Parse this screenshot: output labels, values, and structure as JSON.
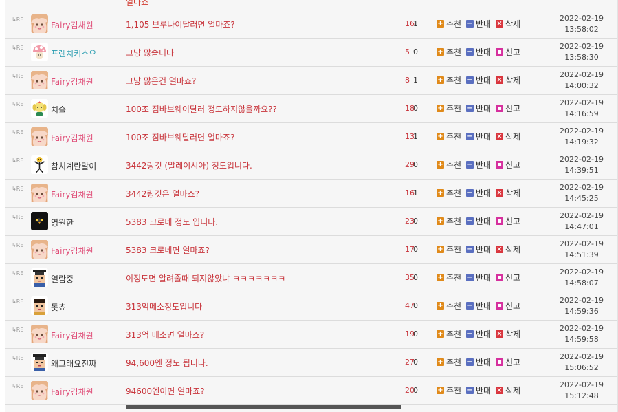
{
  "top": {
    "cut_text": "얼마죠"
  },
  "labels": {
    "re": "↳RE",
    "recommend": "추천",
    "oppose": "반대",
    "delete": "삭제",
    "report": "신고"
  },
  "rows": [
    {
      "nick": "Fairy김채원",
      "nick_color": "pink",
      "avatar": "fairy",
      "content": "1,105 브루나이달러면 얼마죠?",
      "up": "16",
      "down": "1",
      "action": "delete",
      "date": "2022-02-19",
      "time": "13:58:02"
    },
    {
      "nick": "프렌치키스으",
      "nick_color": "teal",
      "avatar": "mushroom",
      "content": "그냥 많습니다",
      "up": "5",
      "down": "0",
      "action": "report",
      "date": "2022-02-19",
      "time": "13:58:30"
    },
    {
      "nick": "Fairy김채원",
      "nick_color": "pink",
      "avatar": "fairy",
      "content": "그냥 많은건 얼마죠?",
      "up": "8",
      "down": "1",
      "action": "delete",
      "date": "2022-02-19",
      "time": "14:00:32"
    },
    {
      "nick": "치슬",
      "nick_color": "dark",
      "avatar": "dog",
      "content": "100조 짐바브웨이달러 정도하지않을까요??",
      "up": "18",
      "down": "0",
      "action": "report",
      "date": "2022-02-19",
      "time": "14:16:59"
    },
    {
      "nick": "Fairy김채원",
      "nick_color": "pink",
      "avatar": "fairy",
      "content": "100조 짐바브웨달러면 얼마죠?",
      "up": "13",
      "down": "1",
      "action": "delete",
      "date": "2022-02-19",
      "time": "14:19:32"
    },
    {
      "nick": "참치계란말이",
      "nick_color": "dark",
      "avatar": "stick",
      "content": "3442링깃 (말레이시아) 정도입니다.",
      "up": "29",
      "down": "0",
      "action": "report",
      "date": "2022-02-19",
      "time": "14:39:51"
    },
    {
      "nick": "Fairy김채원",
      "nick_color": "pink",
      "avatar": "fairy",
      "content": "3442링깃은 얼마죠?",
      "up": "16",
      "down": "1",
      "action": "delete",
      "date": "2022-02-19",
      "time": "14:45:25"
    },
    {
      "nick": "영원한",
      "nick_color": "dark",
      "avatar": "bird",
      "content": "5383 크로네 정도 입니다.",
      "up": "23",
      "down": "0",
      "action": "report",
      "date": "2022-02-19",
      "time": "14:47:01"
    },
    {
      "nick": "Fairy김채원",
      "nick_color": "pink",
      "avatar": "fairy",
      "content": "5383 크로네면 얼마죠?",
      "up": "17",
      "down": "0",
      "action": "delete",
      "date": "2022-02-19",
      "time": "14:51:39"
    },
    {
      "nick": "열람중",
      "nick_color": "dark",
      "avatar": "grad",
      "content": "이정도면 알려줄때 되지않았냐 ㅋㅋㅋㅋㅋㅋㅋ",
      "up": "35",
      "down": "0",
      "action": "report",
      "date": "2022-02-19",
      "time": "14:58:07"
    },
    {
      "nick": "돗쵸",
      "nick_color": "dark",
      "avatar": "boy",
      "content": "313억메소정도입니다",
      "up": "47",
      "down": "0",
      "action": "report",
      "date": "2022-02-19",
      "time": "14:59:36"
    },
    {
      "nick": "Fairy김채원",
      "nick_color": "pink",
      "avatar": "fairy",
      "content": "313억 메소면 얼마죠?",
      "up": "19",
      "down": "0",
      "action": "delete",
      "date": "2022-02-19",
      "time": "14:59:58"
    },
    {
      "nick": "왜그래요진짜",
      "nick_color": "dark",
      "avatar": "grad",
      "content": "94,600엔 정도 됩니다.",
      "up": "27",
      "down": "0",
      "action": "report",
      "date": "2022-02-19",
      "time": "15:06:52"
    },
    {
      "nick": "Fairy김채원",
      "nick_color": "pink",
      "avatar": "fairy",
      "content": "94600엔이면 얼마죠?",
      "up": "20",
      "down": "0",
      "action": "delete",
      "date": "2022-02-19",
      "time": "15:12:48"
    }
  ]
}
